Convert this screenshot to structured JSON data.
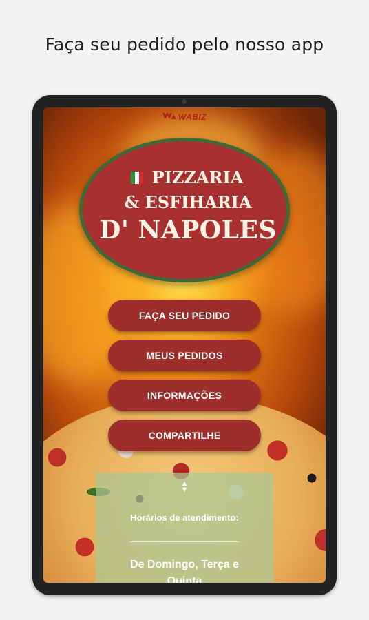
{
  "headline": "Faça seu pedido pelo nosso app",
  "brand": {
    "wabiz": "WABIZ"
  },
  "logo": {
    "line1": "PIZZARIA",
    "line2": "& ESFIHARIA",
    "line3": "D' NAPOLES",
    "flag_colors": [
      "#2f8f3a",
      "#ffffff",
      "#d22d2b"
    ]
  },
  "menu": [
    {
      "label": "FAÇA SEU PEDIDO"
    },
    {
      "label": "MEUS PEDIDOS"
    },
    {
      "label": "INFORMAÇÕES"
    },
    {
      "label": "COMPARTILHE"
    }
  ],
  "hours": {
    "title": "Horários de atendimento:",
    "days_line1": "De Domingo, Terça e",
    "days_line2": "Quinta"
  },
  "colors": {
    "button": "#9e2e2c",
    "logo_fill": "#a8312f",
    "logo_border": "#3d6a37"
  }
}
